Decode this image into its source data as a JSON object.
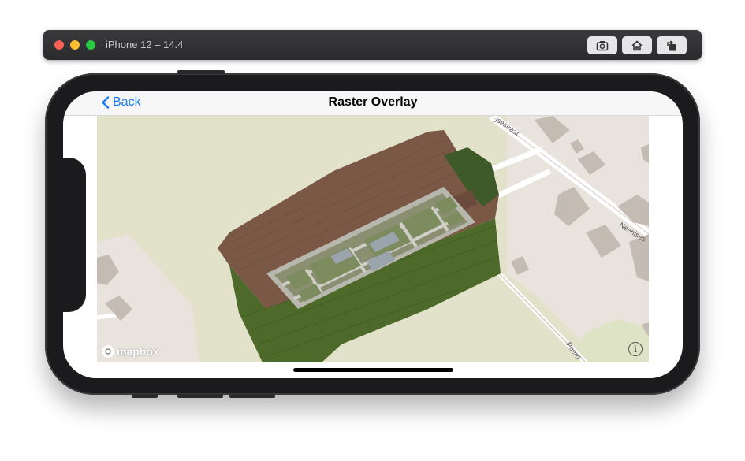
{
  "simulator": {
    "title": "iPhone 12 – 14.4",
    "buttons": [
      "screenshot-icon",
      "home-icon",
      "rotate-icon"
    ]
  },
  "navbar": {
    "back_label": "Back",
    "title": "Raster Overlay"
  },
  "map": {
    "street_labels": [
      "jsestraat",
      "Neerijses",
      "Peerd"
    ],
    "attribution": "mapbox",
    "colors": {
      "land": "#e2e1c9",
      "building": "#c4bcb3",
      "road": "#ffffff",
      "field": "#7b5846",
      "crop": "#4d6a2a"
    }
  }
}
